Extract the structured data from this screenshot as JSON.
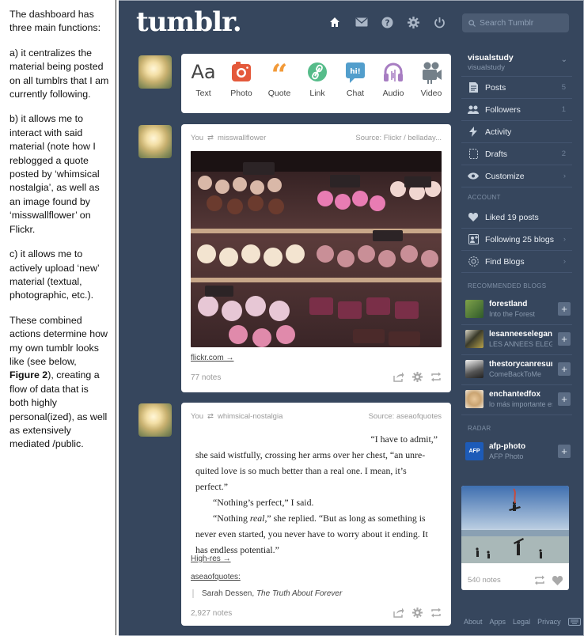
{
  "annotation": {
    "p1": "The dashboard has three main functions:",
    "p2": "a) it centralizes the material being posted on all tumblrs that I am currently following.",
    "p3a": "b) it allows me to interact with said material (note how I reblogged a quote posted by ‘whimsical nostalgia’, as well as an image found by ‘misswallflower’ on Flickr.",
    "p4": "c) it allows me to actively upload ‘new’ material (textual, photographic, etc.).",
    "p5a": "These combined actions determine how my own tumblr looks like (see below, ",
    "p5b": "Figure 2",
    "p5c": "), creating a flow of data that is both highly personal(ized), as well as extensively mediated /public."
  },
  "header": {
    "logo": "tumblr.",
    "search_placeholder": "Search Tumblr",
    "icons": [
      "home-icon",
      "mail-icon",
      "help-icon",
      "gear-icon",
      "power-icon"
    ]
  },
  "post_types": [
    {
      "label": "Text",
      "color": "#444444"
    },
    {
      "label": "Photo",
      "color": "#e4593b"
    },
    {
      "label": "Quote",
      "color": "#f29a38"
    },
    {
      "label": "Link",
      "color": "#56bc8a"
    },
    {
      "label": "Chat",
      "color": "#529ecc"
    },
    {
      "label": "Audio",
      "color": "#a77dc2"
    },
    {
      "label": "Video",
      "color": "#748089"
    }
  ],
  "posts": [
    {
      "author": "You",
      "reblogged_from": "misswallflower",
      "source": "Source: Flickr / belladay...",
      "link_text": "flickr.com →",
      "notes": "77 notes"
    },
    {
      "author": "You",
      "reblogged_from": "whimsical-nostalgia",
      "source": "Source: aseaofquotes",
      "quote_lines": [
        "“I have to admit,”",
        "she said wistfully, crossing her arms over her chest, “an unre-quited love is so much better than a real one. I mean, it’s perfect.”",
        "“Nothing’s perfect,” I said.",
        "“Nothing real,” she replied. “But as long as something is never even started, you never have to worry about it ending. It has endless potential.”"
      ],
      "quote_parts": {
        "l4a": "“Nothing ",
        "l4b": "real",
        "l4c": ",” she replied. “But as long as something is never even started, you never have to worry about it ending. It has endless potential.”"
      },
      "link_text": "High-res →",
      "source_blog": "aseaofquotes:",
      "citation_author": "Sarah Dessen, ",
      "citation_title": "The Truth About Forever",
      "notes": "2,927 notes"
    }
  ],
  "sidebar": {
    "account_name": "visualstudy",
    "account_sub": "visualstudy",
    "items": [
      {
        "label": "Posts",
        "count": "5"
      },
      {
        "label": "Followers",
        "count": "1"
      },
      {
        "label": "Activity",
        "count": ""
      },
      {
        "label": "Drafts",
        "count": "2"
      },
      {
        "label": "Customize",
        "count": "›"
      }
    ],
    "account_heading": "ACCOUNT",
    "account_items": [
      {
        "label": "Liked 19 posts",
        "count": ""
      },
      {
        "label": "Following 25 blogs",
        "count": "›"
      },
      {
        "label": "Find Blogs",
        "count": "›"
      }
    ],
    "recommended_heading": "RECOMMENDED BLOGS",
    "recommended": [
      {
        "name": "forestland",
        "sub": "Into the Forest"
      },
      {
        "name": "lesanneeselegantes",
        "sub": "LES ANNEES ELEGANTES"
      },
      {
        "name": "thestorycanresume",
        "sub": "ComeBackToMe"
      },
      {
        "name": "enchantedfox",
        "sub": "lo más importante es"
      }
    ],
    "radar_heading": "RADAR",
    "radar": {
      "name": "afp-photo",
      "sub": "AFP Photo",
      "badge": "AFP",
      "notes": "540 notes"
    },
    "footer": [
      "About",
      "Apps",
      "Legal",
      "Privacy"
    ]
  },
  "colors": {
    "background": "#36465d",
    "accent": "#529ecc"
  }
}
